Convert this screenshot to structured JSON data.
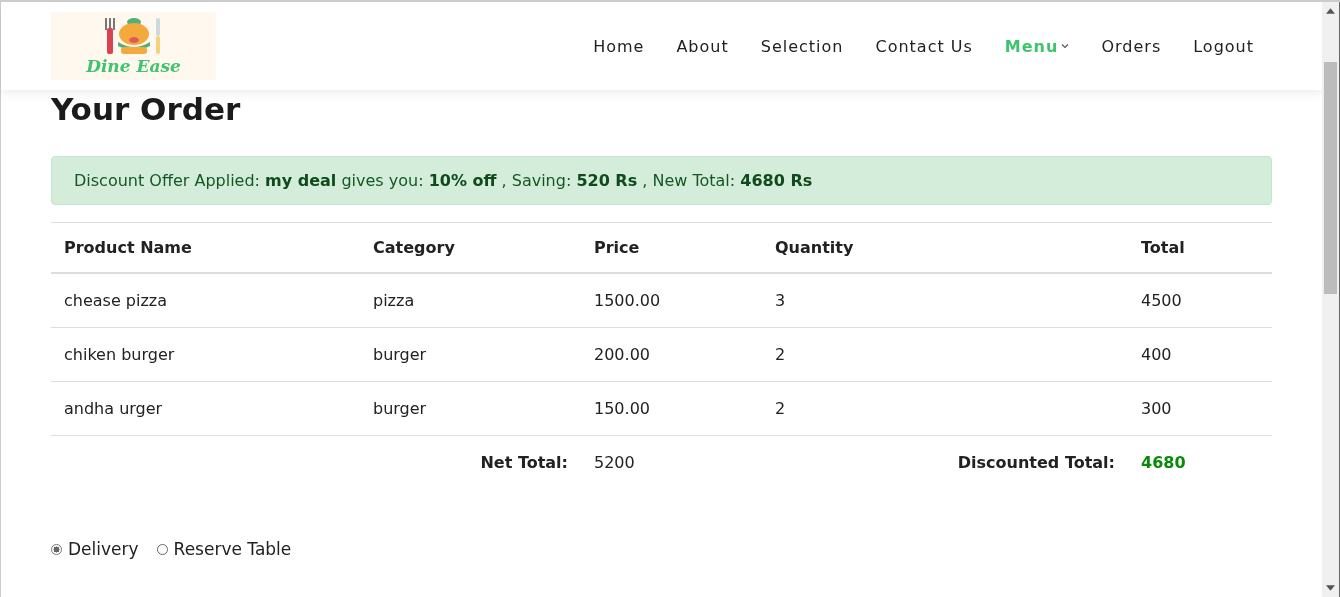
{
  "logo": {
    "text": "Dine Ease"
  },
  "nav": [
    {
      "label": "Home",
      "selected": false,
      "dropdown": false
    },
    {
      "label": "About",
      "selected": false,
      "dropdown": false
    },
    {
      "label": "Selection",
      "selected": false,
      "dropdown": false
    },
    {
      "label": "Contact Us",
      "selected": false,
      "dropdown": false
    },
    {
      "label": "Menu",
      "selected": true,
      "dropdown": true
    },
    {
      "label": "Orders",
      "selected": false,
      "dropdown": false
    },
    {
      "label": "Logout",
      "selected": false,
      "dropdown": false
    }
  ],
  "title": "Your Order",
  "discount_alert": "Discount Offer Applied: **my deal** gives you: **10% off** , Saving: **520 Rs** , New Total: **4680 Rs**",
  "table": {
    "columns": [
      "Product Name",
      "Category",
      "Price",
      "Quantity",
      "Total"
    ],
    "rows": [
      [
        "chease pizza",
        "pizza",
        "1500.00",
        "3",
        "4500"
      ],
      [
        "chiken burger",
        "burger",
        "200.00",
        "2",
        "400"
      ],
      [
        "andha urger",
        "burger",
        "150.00",
        "2",
        "300"
      ]
    ],
    "footer": {
      "net_total_label": "Net Total:",
      "net_total": "5200",
      "discounted_total_label": "Discounted Total:",
      "discounted_total": "4680"
    }
  },
  "order_type": [
    {
      "label": "Delivery",
      "selected": true
    },
    {
      "label": "Reserve Table",
      "selected": false
    }
  ]
}
